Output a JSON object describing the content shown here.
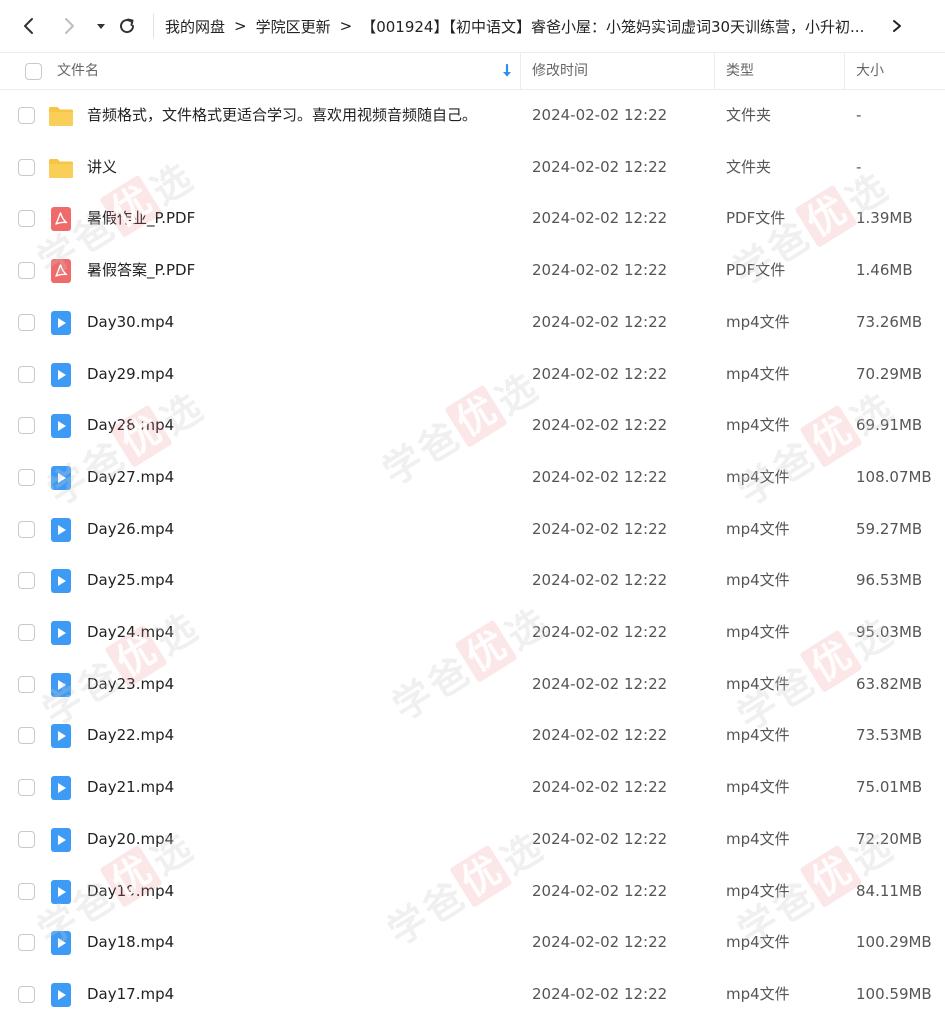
{
  "toolbar": {
    "back_icon": "chevron-left-icon",
    "forward_icon": "chevron-right-icon",
    "history_icon": "caret-down-icon",
    "refresh_icon": "refresh-icon",
    "breadcrumb": [
      "我的网盘",
      "学院区更新",
      "【001924】【初中语文】睿爸小屋：小笼妈实词虚词30天训练营，小升初..."
    ],
    "breadcrumb_separator": ">",
    "more_icon": "chevron-right-icon"
  },
  "header": {
    "name": "文件名",
    "modified": "修改时间",
    "type": "类型",
    "size": "大小",
    "sort_icon": "sort-down-arrow-icon"
  },
  "files": [
    {
      "name": "音频格式，文件格式更适合学习。喜欢用视频音频随自己。",
      "date": "2024-02-02 12:22",
      "type": "文件夹",
      "size": "-",
      "icon": "folder"
    },
    {
      "name": "讲义",
      "date": "2024-02-02 12:22",
      "type": "文件夹",
      "size": "-",
      "icon": "folder"
    },
    {
      "name": "暑假作业_P.PDF",
      "date": "2024-02-02 12:22",
      "type": "PDF文件",
      "size": "1.39MB",
      "icon": "pdf"
    },
    {
      "name": "暑假答案_P.PDF",
      "date": "2024-02-02 12:22",
      "type": "PDF文件",
      "size": "1.46MB",
      "icon": "pdf"
    },
    {
      "name": "Day30.mp4",
      "date": "2024-02-02 12:22",
      "type": "mp4文件",
      "size": "73.26MB",
      "icon": "video"
    },
    {
      "name": "Day29.mp4",
      "date": "2024-02-02 12:22",
      "type": "mp4文件",
      "size": "70.29MB",
      "icon": "video"
    },
    {
      "name": "Day28.mp4",
      "date": "2024-02-02 12:22",
      "type": "mp4文件",
      "size": "69.91MB",
      "icon": "video"
    },
    {
      "name": "Day27.mp4",
      "date": "2024-02-02 12:22",
      "type": "mp4文件",
      "size": "108.07MB",
      "icon": "video"
    },
    {
      "name": "Day26.mp4",
      "date": "2024-02-02 12:22",
      "type": "mp4文件",
      "size": "59.27MB",
      "icon": "video"
    },
    {
      "name": "Day25.mp4",
      "date": "2024-02-02 12:22",
      "type": "mp4文件",
      "size": "96.53MB",
      "icon": "video"
    },
    {
      "name": "Day24.mp4",
      "date": "2024-02-02 12:22",
      "type": "mp4文件",
      "size": "95.03MB",
      "icon": "video"
    },
    {
      "name": "Day23.mp4",
      "date": "2024-02-02 12:22",
      "type": "mp4文件",
      "size": "63.82MB",
      "icon": "video"
    },
    {
      "name": "Day22.mp4",
      "date": "2024-02-02 12:22",
      "type": "mp4文件",
      "size": "73.53MB",
      "icon": "video"
    },
    {
      "name": "Day21.mp4",
      "date": "2024-02-02 12:22",
      "type": "mp4文件",
      "size": "75.01MB",
      "icon": "video"
    },
    {
      "name": "Day20.mp4",
      "date": "2024-02-02 12:22",
      "type": "mp4文件",
      "size": "72.20MB",
      "icon": "video"
    },
    {
      "name": "Day19.mp4",
      "date": "2024-02-02 12:22",
      "type": "mp4文件",
      "size": "84.11MB",
      "icon": "video"
    },
    {
      "name": "Day18.mp4",
      "date": "2024-02-02 12:22",
      "type": "mp4文件",
      "size": "100.29MB",
      "icon": "video"
    },
    {
      "name": "Day17.mp4",
      "date": "2024-02-02 12:22",
      "type": "mp4文件",
      "size": "100.59MB",
      "icon": "video"
    }
  ],
  "watermark": {
    "chars": [
      "学",
      "爸",
      "优",
      "选"
    ]
  },
  "colors": {
    "folder": "#f7c543",
    "pdf": "#ef6a6a",
    "video": "#3e9bf5",
    "accent": "#2f8cf5"
  }
}
